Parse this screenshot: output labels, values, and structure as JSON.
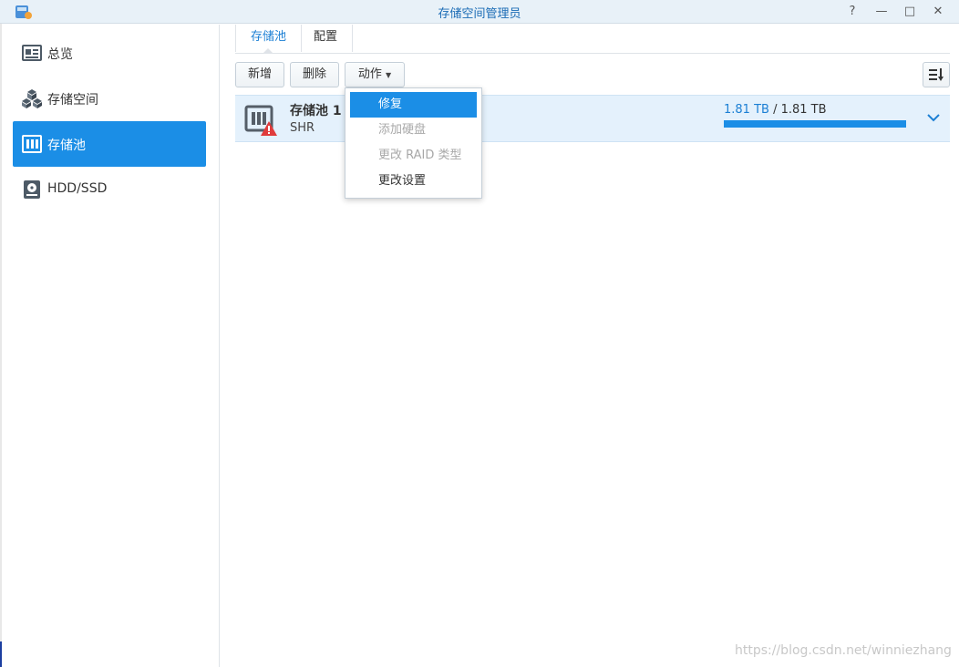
{
  "window": {
    "title": "存储空间管理员",
    "controls": {
      "help": "?",
      "minimize": "—",
      "maximize": "□",
      "close": "✕"
    }
  },
  "sidebar": {
    "items": [
      {
        "label": "总览",
        "icon": "overview-icon",
        "active": false
      },
      {
        "label": "存储空间",
        "icon": "volume-cubes-icon",
        "active": false
      },
      {
        "label": "存储池",
        "icon": "storage-pool-icon",
        "active": true
      },
      {
        "label": "HDD/SSD",
        "icon": "hdd-icon",
        "active": false
      }
    ]
  },
  "tabs": [
    {
      "label": "存储池",
      "active": true
    },
    {
      "label": "配置",
      "active": false
    }
  ],
  "toolbar": {
    "new_label": "新增",
    "delete_label": "删除",
    "action_label": "动作",
    "sort_icon": "sort-icon"
  },
  "pool": {
    "name": "存储池 1",
    "type": "SHR",
    "used": "1.81 TB",
    "separator": " / ",
    "total": "1.81 TB",
    "usage_fraction": 1.0,
    "status_icon": "warning-icon"
  },
  "action_menu": {
    "items": [
      {
        "label": "修复",
        "state": "selected"
      },
      {
        "label": "添加硬盘",
        "state": "disabled"
      },
      {
        "label": "更改 RAID 类型",
        "state": "disabled"
      },
      {
        "label": "更改设置",
        "state": "enabled"
      }
    ]
  },
  "watermark": "https://blog.csdn.net/winniezhang",
  "colors": {
    "accent": "#1b8ee6",
    "selected_row": "#e4f1fc",
    "warning": "#e03c3c"
  }
}
